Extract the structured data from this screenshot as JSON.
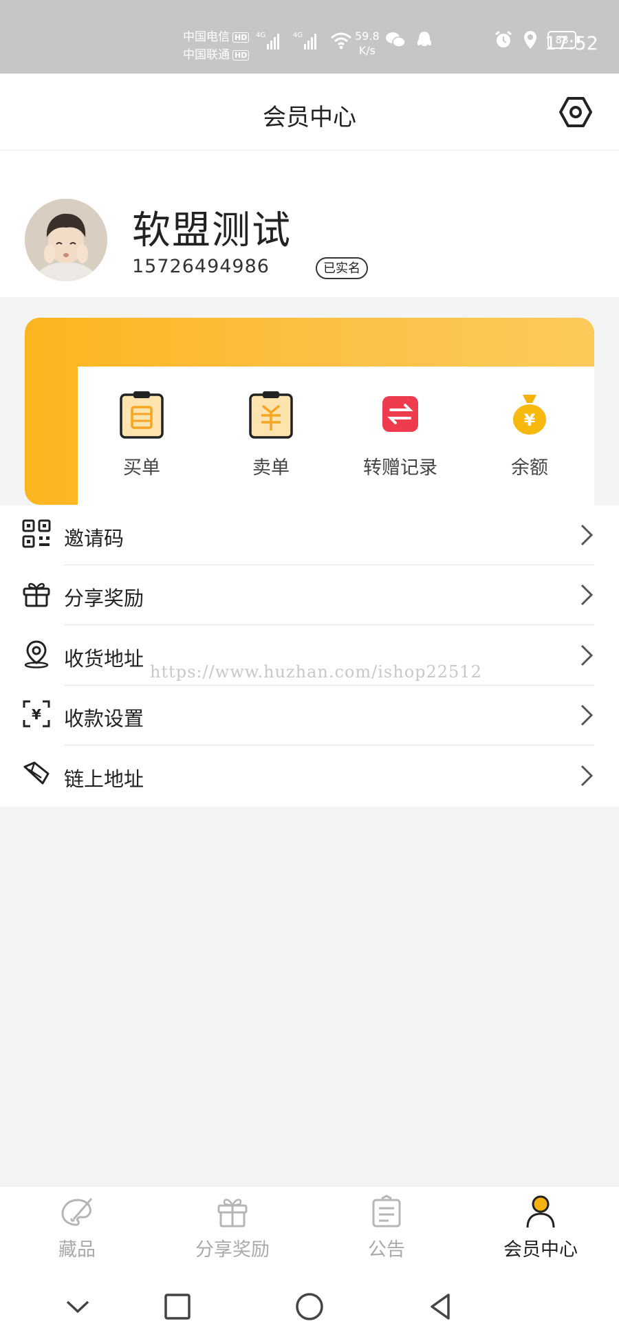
{
  "status_bar": {
    "carrier_1": "中国电信",
    "carrier_2": "中国联通",
    "hd_badge": "HD",
    "network_1": "4G",
    "network_2": "4G",
    "speed_value": "59.8",
    "speed_unit": "K/s",
    "battery": "88",
    "time": "17:52"
  },
  "header": {
    "title": "会员中心",
    "settings_icon": "settings-hex-icon"
  },
  "profile": {
    "name": "软盟测试",
    "phone": "15726494986",
    "verified_badge": "已实名"
  },
  "quick_actions": [
    {
      "label": "买单",
      "icon": "buy-order-clipboard-icon"
    },
    {
      "label": "卖单",
      "icon": "sell-order-clipboard-icon"
    },
    {
      "label": "转赠记录",
      "icon": "transfer-record-icon"
    },
    {
      "label": "余额",
      "icon": "money-bag-icon"
    }
  ],
  "menu": [
    {
      "label": "邀请码",
      "icon": "qr-code-icon"
    },
    {
      "label": "分享奖励",
      "icon": "gift-icon"
    },
    {
      "label": "收货地址",
      "icon": "location-pin-icon"
    },
    {
      "label": "收款设置",
      "icon": "yuan-scan-icon"
    },
    {
      "label": "链上地址",
      "icon": "chain-address-icon"
    }
  ],
  "watermark": "https://www.huzhan.com/ishop22512",
  "tabs": [
    {
      "label": "藏品",
      "icon": "collection-brush-icon",
      "active": false
    },
    {
      "label": "分享奖励",
      "icon": "gift-icon",
      "active": false
    },
    {
      "label": "公告",
      "icon": "notice-board-icon",
      "active": false
    },
    {
      "label": "会员中心",
      "icon": "member-person-icon",
      "active": true
    }
  ],
  "colors": {
    "accent": "#fbb51f",
    "text": "#222222",
    "tab_inactive": "#aaaaaa"
  }
}
